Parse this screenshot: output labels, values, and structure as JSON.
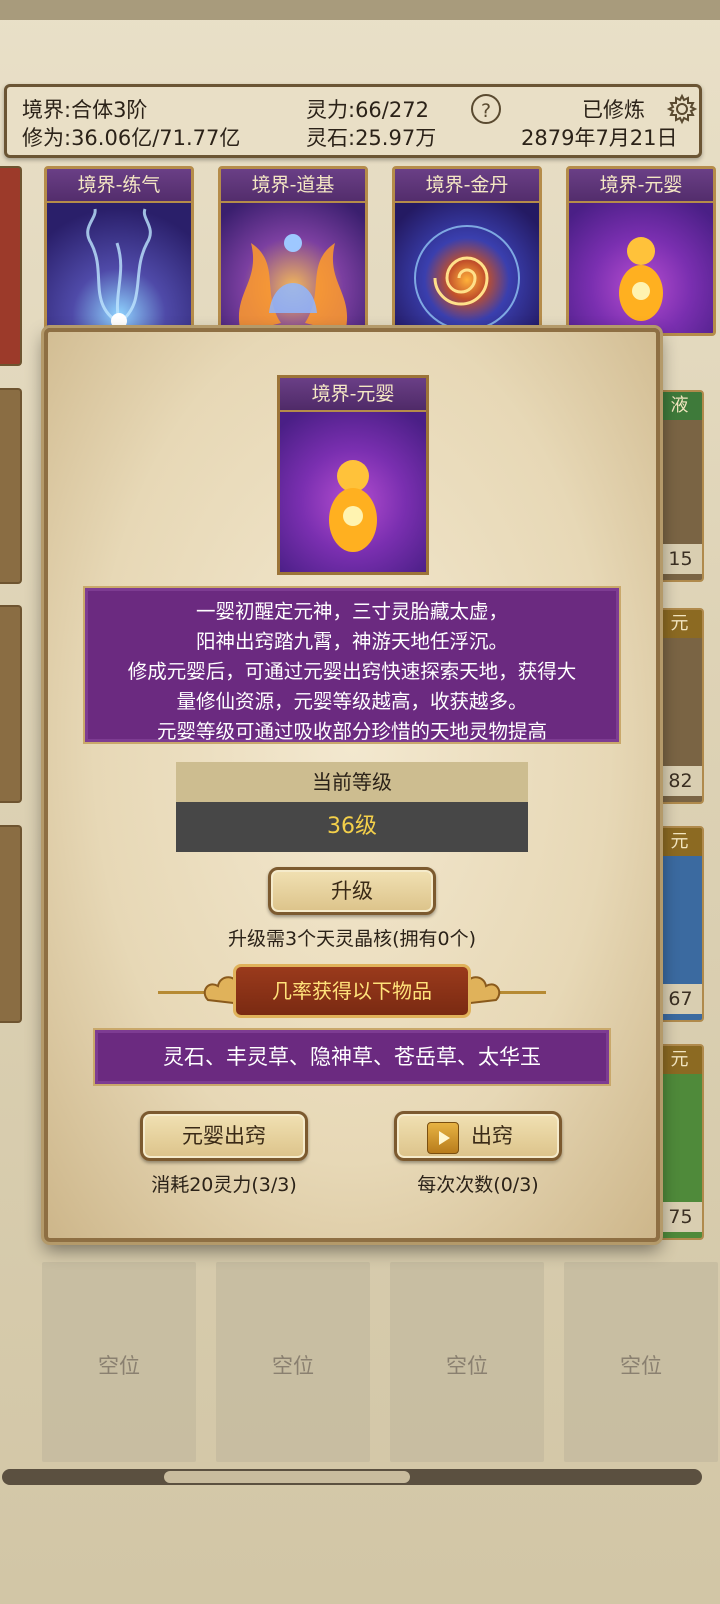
{
  "header": {
    "realm": "境界:合体3阶",
    "cultivation": "修为:36.06亿/71.77亿",
    "spirit_power": "灵力:66/272",
    "spirit_stones": "灵石:25.97万",
    "help_label": "?",
    "status": "已修炼",
    "date": "2879年7月21日"
  },
  "cards": [
    {
      "label": "境界-练气",
      "icon": "smoke-spirit-art"
    },
    {
      "label": "境界-道基",
      "icon": "meditating-flame-art"
    },
    {
      "label": "境界-金丹",
      "icon": "golden-vortex-art"
    },
    {
      "label": "境界-元婴",
      "icon": "golden-infant-art"
    }
  ],
  "side_right": [
    {
      "label": "液",
      "value": "15"
    },
    {
      "label": "元",
      "value": "82"
    },
    {
      "label": "元",
      "value": "67"
    },
    {
      "label": "元",
      "value": "75"
    }
  ],
  "slots": [
    "空位",
    "空位",
    "空位",
    "空位"
  ],
  "scroll": {
    "position": 0.23,
    "visible_fraction": 0.35
  },
  "modal": {
    "card_label": "境界-元婴",
    "description": [
      "一婴初醒定元神，三寸灵胎藏太虚，",
      "阳神出窍踏九霄，神游天地任浮沉。",
      "修成元婴后，可通过元婴出窍快速探索天地，获得大",
      "量修仙资源，元婴等级越高，收获越多。",
      "元婴等级可通过吸收部分珍惜的天地灵物提高"
    ],
    "level_header": "当前等级",
    "level_value": "36级",
    "upgrade_label": "升级",
    "upgrade_note": "升级需3个天灵晶核(拥有0个)",
    "drops_banner": "几率获得以下物品",
    "drops": "灵石、丰灵草、隐神草、苍岳草、太华玉",
    "action1_label": "元婴出窍",
    "action1_note": "消耗20灵力(3/3)",
    "action2_label": "出窍",
    "action2_note": "每次次数(0/3)"
  },
  "colors": {
    "purple": "#6b2a80",
    "gold_text": "#f4d04a",
    "banner": "#8a3218"
  }
}
